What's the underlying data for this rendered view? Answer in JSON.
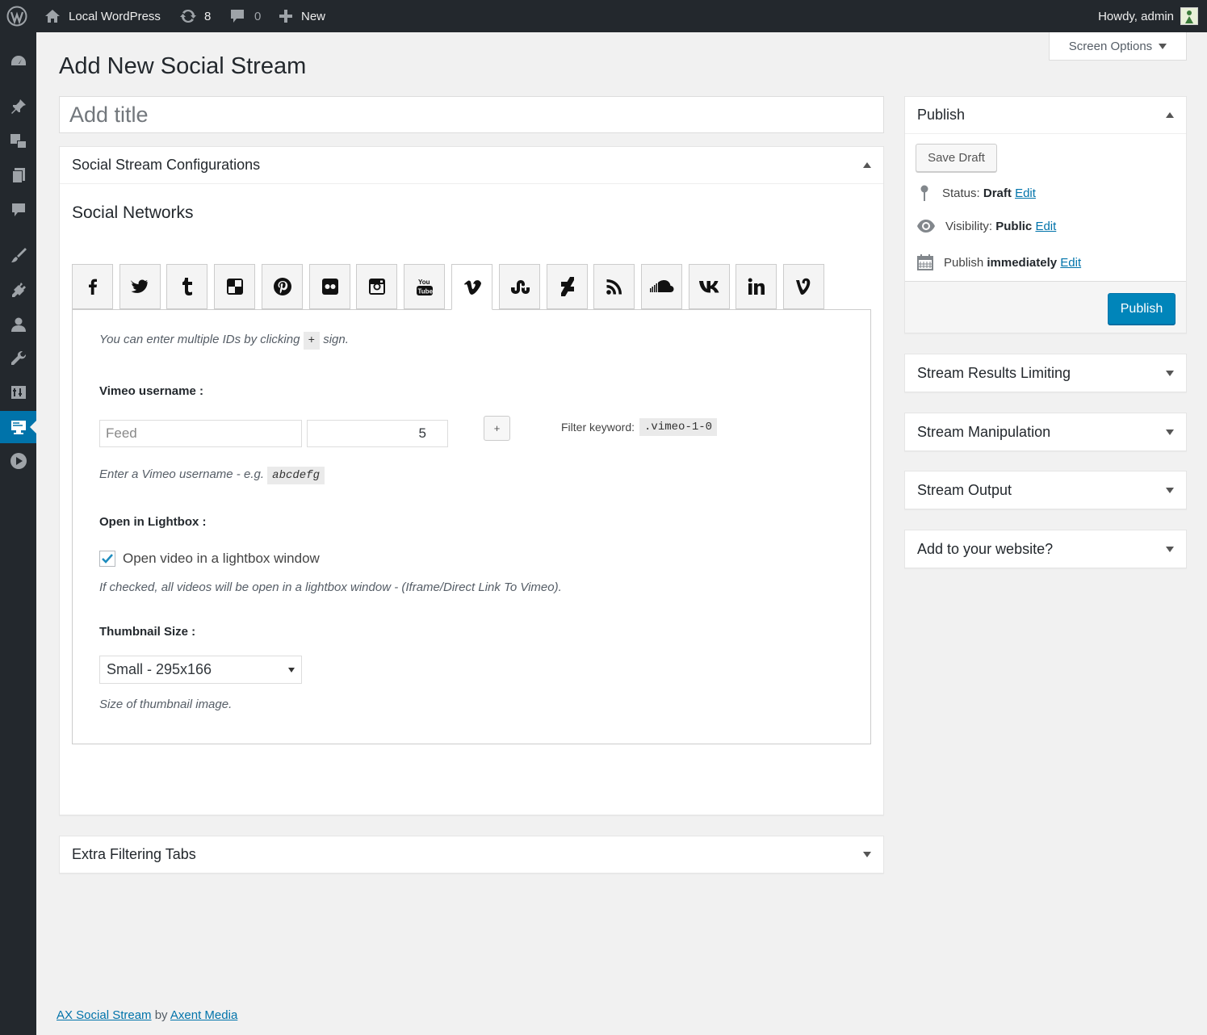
{
  "adminbar": {
    "site_name": "Local WordPress",
    "updates_count": "8",
    "comments_count": "0",
    "new_label": "New",
    "howdy": "Howdy, admin"
  },
  "screen_options": "Screen Options",
  "page": {
    "title": "Add New Social Stream",
    "title_placeholder": "Add title"
  },
  "config_box": {
    "title": "Social Stream Configurations",
    "networks_title": "Social Networks",
    "active_network": "vimeo",
    "networks": [
      "facebook",
      "twitter",
      "tumblr",
      "delicious",
      "pinterest",
      "flickr",
      "instagram",
      "youtube",
      "vimeo",
      "stumbleupon",
      "deviantart",
      "rss",
      "soundcloud",
      "vk",
      "linkedin",
      "vine"
    ],
    "help_multiple_pre": "You can enter multiple IDs by clicking",
    "help_multiple_code": "+",
    "help_multiple_post": "sign.",
    "vimeo_label": "Vimeo username :",
    "feed_placeholder": "Feed",
    "count_value": "5",
    "plus_label": "+",
    "filter_label": "Filter keyword:",
    "filter_code": ".vimeo-1-0",
    "username_help_pre": "Enter a Vimeo username - e.g.",
    "username_help_code": "abcdefg",
    "lightbox_label": "Open in Lightbox :",
    "lightbox_checkbox_label": "Open video in a lightbox window",
    "lightbox_checked": true,
    "lightbox_help": "If checked, all videos will be open in a lightbox window - (Iframe/Direct Link To Vimeo).",
    "thumb_label": "Thumbnail Size :",
    "thumb_value": "Small - 295x166",
    "thumb_help": "Size of thumbnail image."
  },
  "extra_box": {
    "title": "Extra Filtering Tabs"
  },
  "publish_box": {
    "title": "Publish",
    "save_draft": "Save Draft",
    "status_label": "Status:",
    "status_value": "Draft",
    "visibility_label": "Visibility:",
    "visibility_value": "Public",
    "publish_label": "Publish",
    "publish_value": "immediately",
    "edit_label": "Edit",
    "publish_button": "Publish"
  },
  "side_boxes": [
    "Stream Results Limiting",
    "Stream Manipulation",
    "Stream Output",
    "Add to your website?"
  ],
  "footer": {
    "plugin_link": "AX Social Stream",
    "by": "by",
    "author_link": "Axent Media"
  },
  "colors": {
    "primary": "#0085ba",
    "adminbar": "#23282d",
    "link": "#0073aa"
  }
}
